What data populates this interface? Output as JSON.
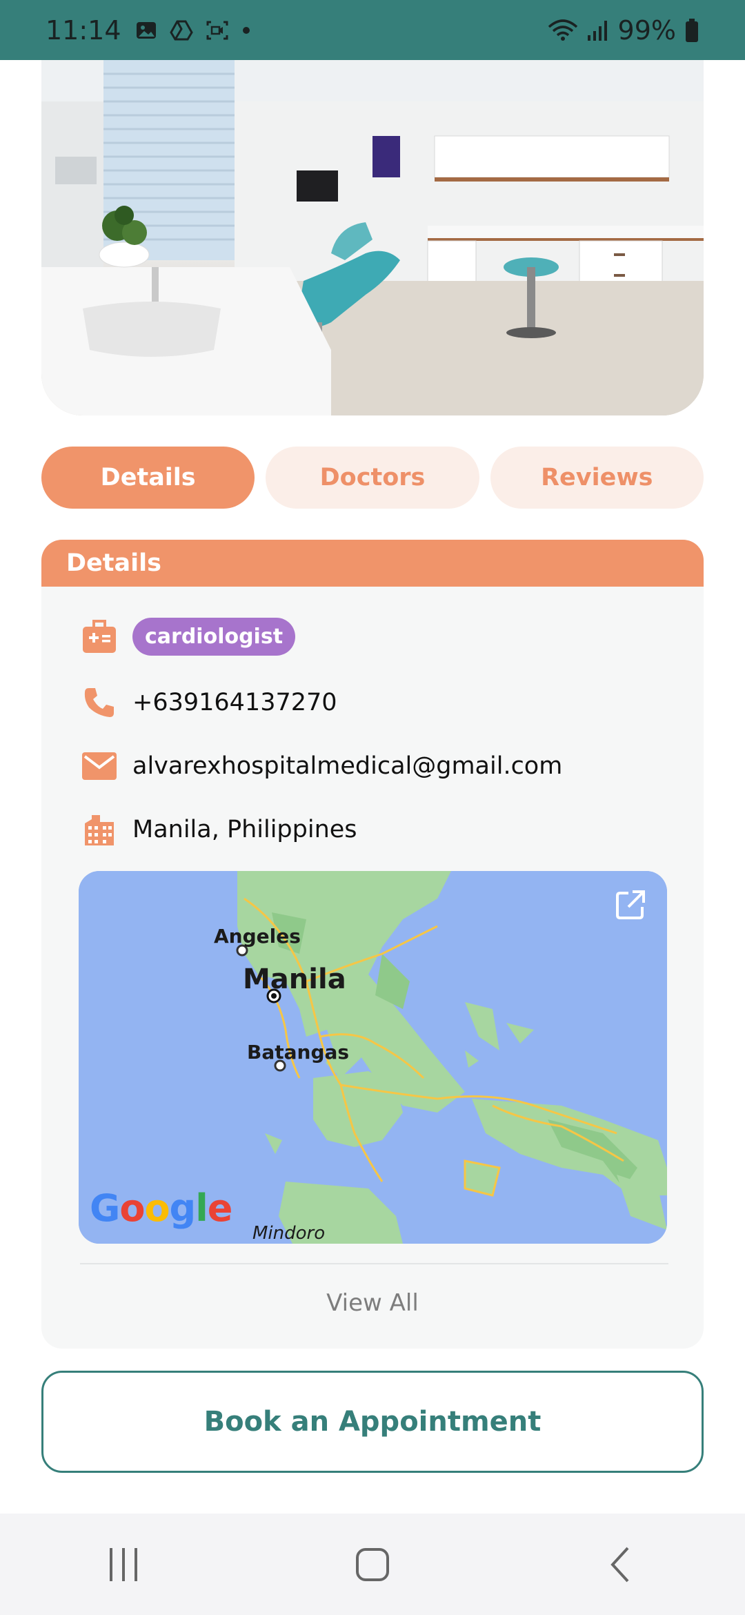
{
  "status_bar": {
    "time": "11:14",
    "battery": "99%"
  },
  "tabs": [
    {
      "label": "Details",
      "active": true
    },
    {
      "label": "Doctors",
      "active": false
    },
    {
      "label": "Reviews",
      "active": false
    }
  ],
  "details": {
    "title": "Details",
    "specialty": "cardiologist",
    "phone": "+639164137270",
    "email": "alvarexhospitalmedical@gmail.com",
    "location": "Manila, Philippines"
  },
  "map": {
    "labels": {
      "angeles": "Angeles",
      "manila": "Manila",
      "batangas": "Batangas",
      "mindoro": "Mindoro"
    },
    "google_logo": "Google"
  },
  "view_all": "View All",
  "book_button": "Book an Appointment",
  "colors": {
    "brand": "#367f7a",
    "accent": "#f0946a",
    "tab_inactive_bg": "#fbeee8",
    "badge": "#a774cc"
  },
  "icons": {
    "specialty": "medical-bag-icon",
    "phone": "phone-icon",
    "email": "mail-icon",
    "location": "building-icon",
    "open_external": "open-external-icon"
  }
}
